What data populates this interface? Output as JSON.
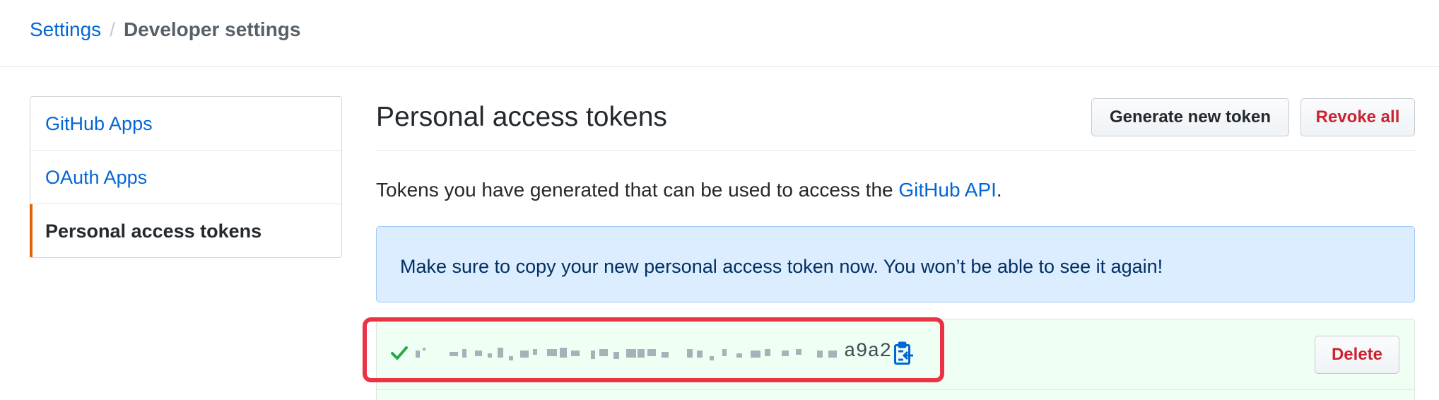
{
  "breadcrumb": {
    "root": "Settings",
    "separator": "/",
    "current": "Developer settings"
  },
  "sidebar": {
    "items": [
      {
        "label": "GitHub Apps",
        "selected": false
      },
      {
        "label": "OAuth Apps",
        "selected": false
      },
      {
        "label": "Personal access tokens",
        "selected": true
      }
    ]
  },
  "main": {
    "title": "Personal access tokens",
    "generate_button": "Generate new token",
    "revoke_button": "Revoke all",
    "description_prefix": "Tokens you have generated that can be used to access the ",
    "description_link": "GitHub API",
    "description_suffix": ".",
    "flash_message": "Make sure to copy your new personal access token now. You won’t be able to see it again!",
    "token": {
      "visible_suffix": "a9a2",
      "status_icon": "check-icon",
      "copy_icon": "clipboard-icon",
      "delete_button": "Delete",
      "redacted": true
    }
  },
  "colors": {
    "link": "#0366d6",
    "danger": "#cb2431",
    "selected_accent": "#e36209",
    "flash_bg": "#dbedff",
    "token_bg": "#f0fff4",
    "success": "#28a745",
    "highlight": "#ea3344"
  }
}
